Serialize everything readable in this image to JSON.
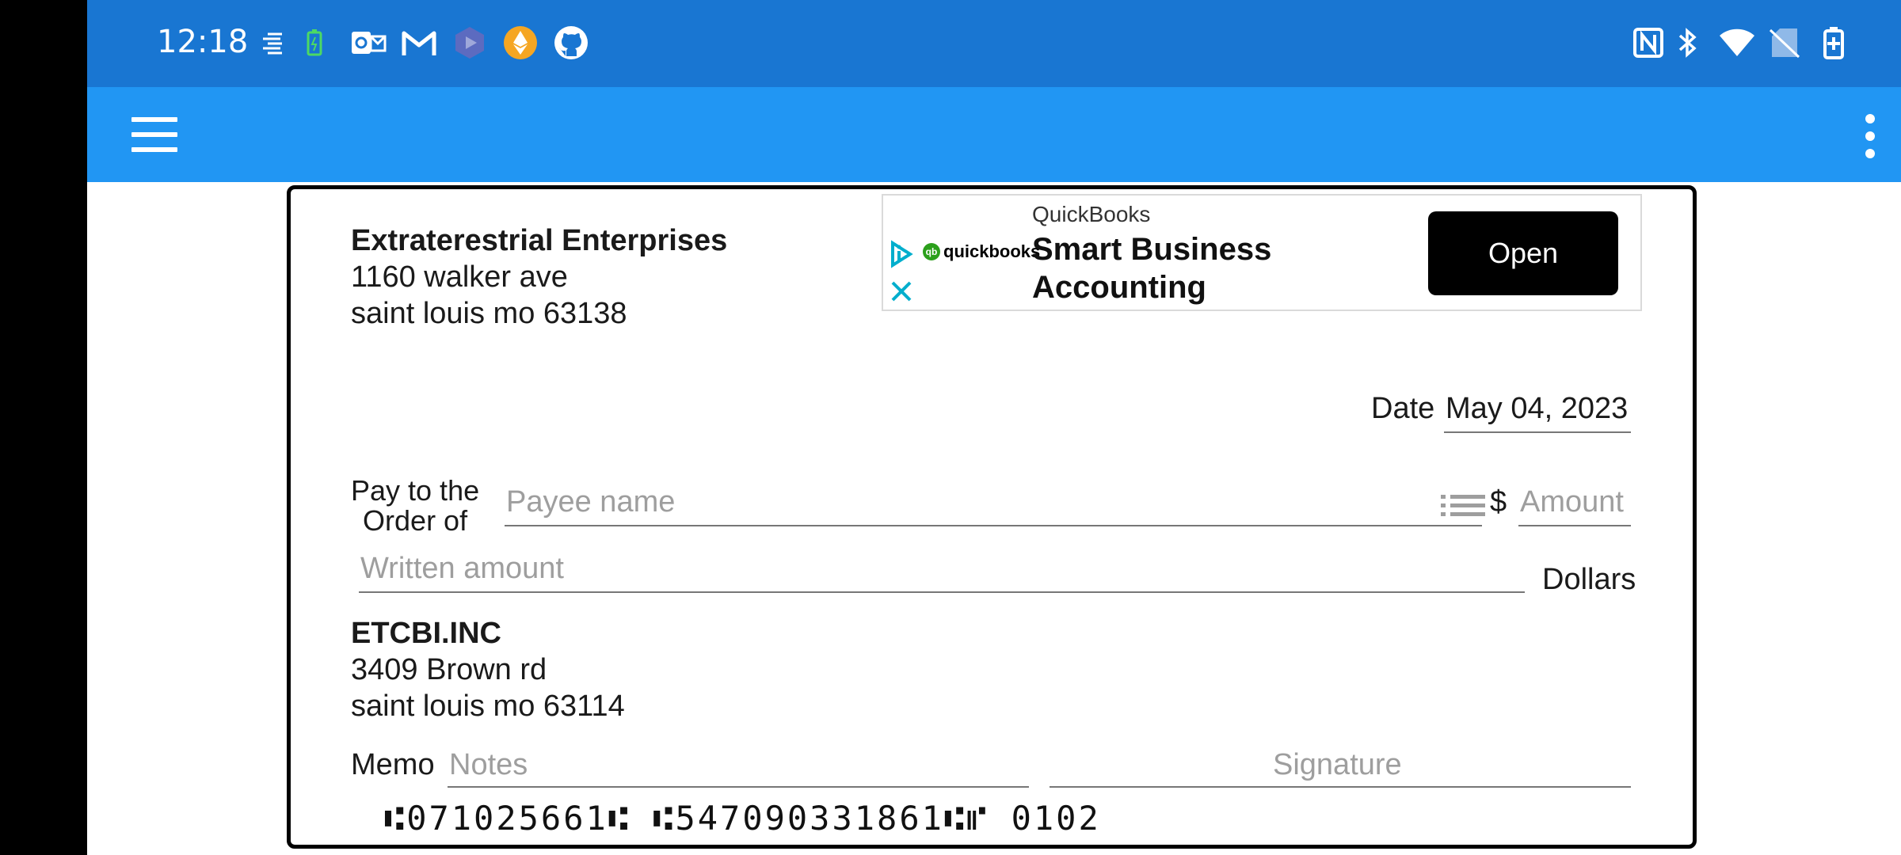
{
  "status_bar": {
    "time": "12:18"
  },
  "ad": {
    "brand": "QuickBooks",
    "headline": "Smart Business Accounting",
    "open_label": "Open",
    "logo_text": "quickbooks"
  },
  "check": {
    "sender": {
      "name": "Extraterestrial Enterprises",
      "line1": "1160 walker ave",
      "line2": "saint louis mo 63138"
    },
    "date_label": "Date",
    "date_value": "May 04, 2023",
    "pay_to_line1": "Pay to the",
    "pay_to_line2": "Order of",
    "payee_placeholder": "Payee name",
    "currency_symbol": "$",
    "amount_placeholder": "Amount",
    "written_amount_placeholder": "Written amount",
    "dollars_label": "Dollars",
    "bank": {
      "name": "ETCBI.INC",
      "line1": "3409 Brown rd",
      "line2": "saint louis mo 63114"
    },
    "memo_label": "Memo",
    "memo_placeholder": "Notes",
    "signature_placeholder": "Signature",
    "micr_line": "⑆071025661⑆  ⑆547090331861⑆⑈  0102"
  },
  "colors": {
    "status_bar": "#1976d2",
    "app_bar": "#2196f3"
  }
}
